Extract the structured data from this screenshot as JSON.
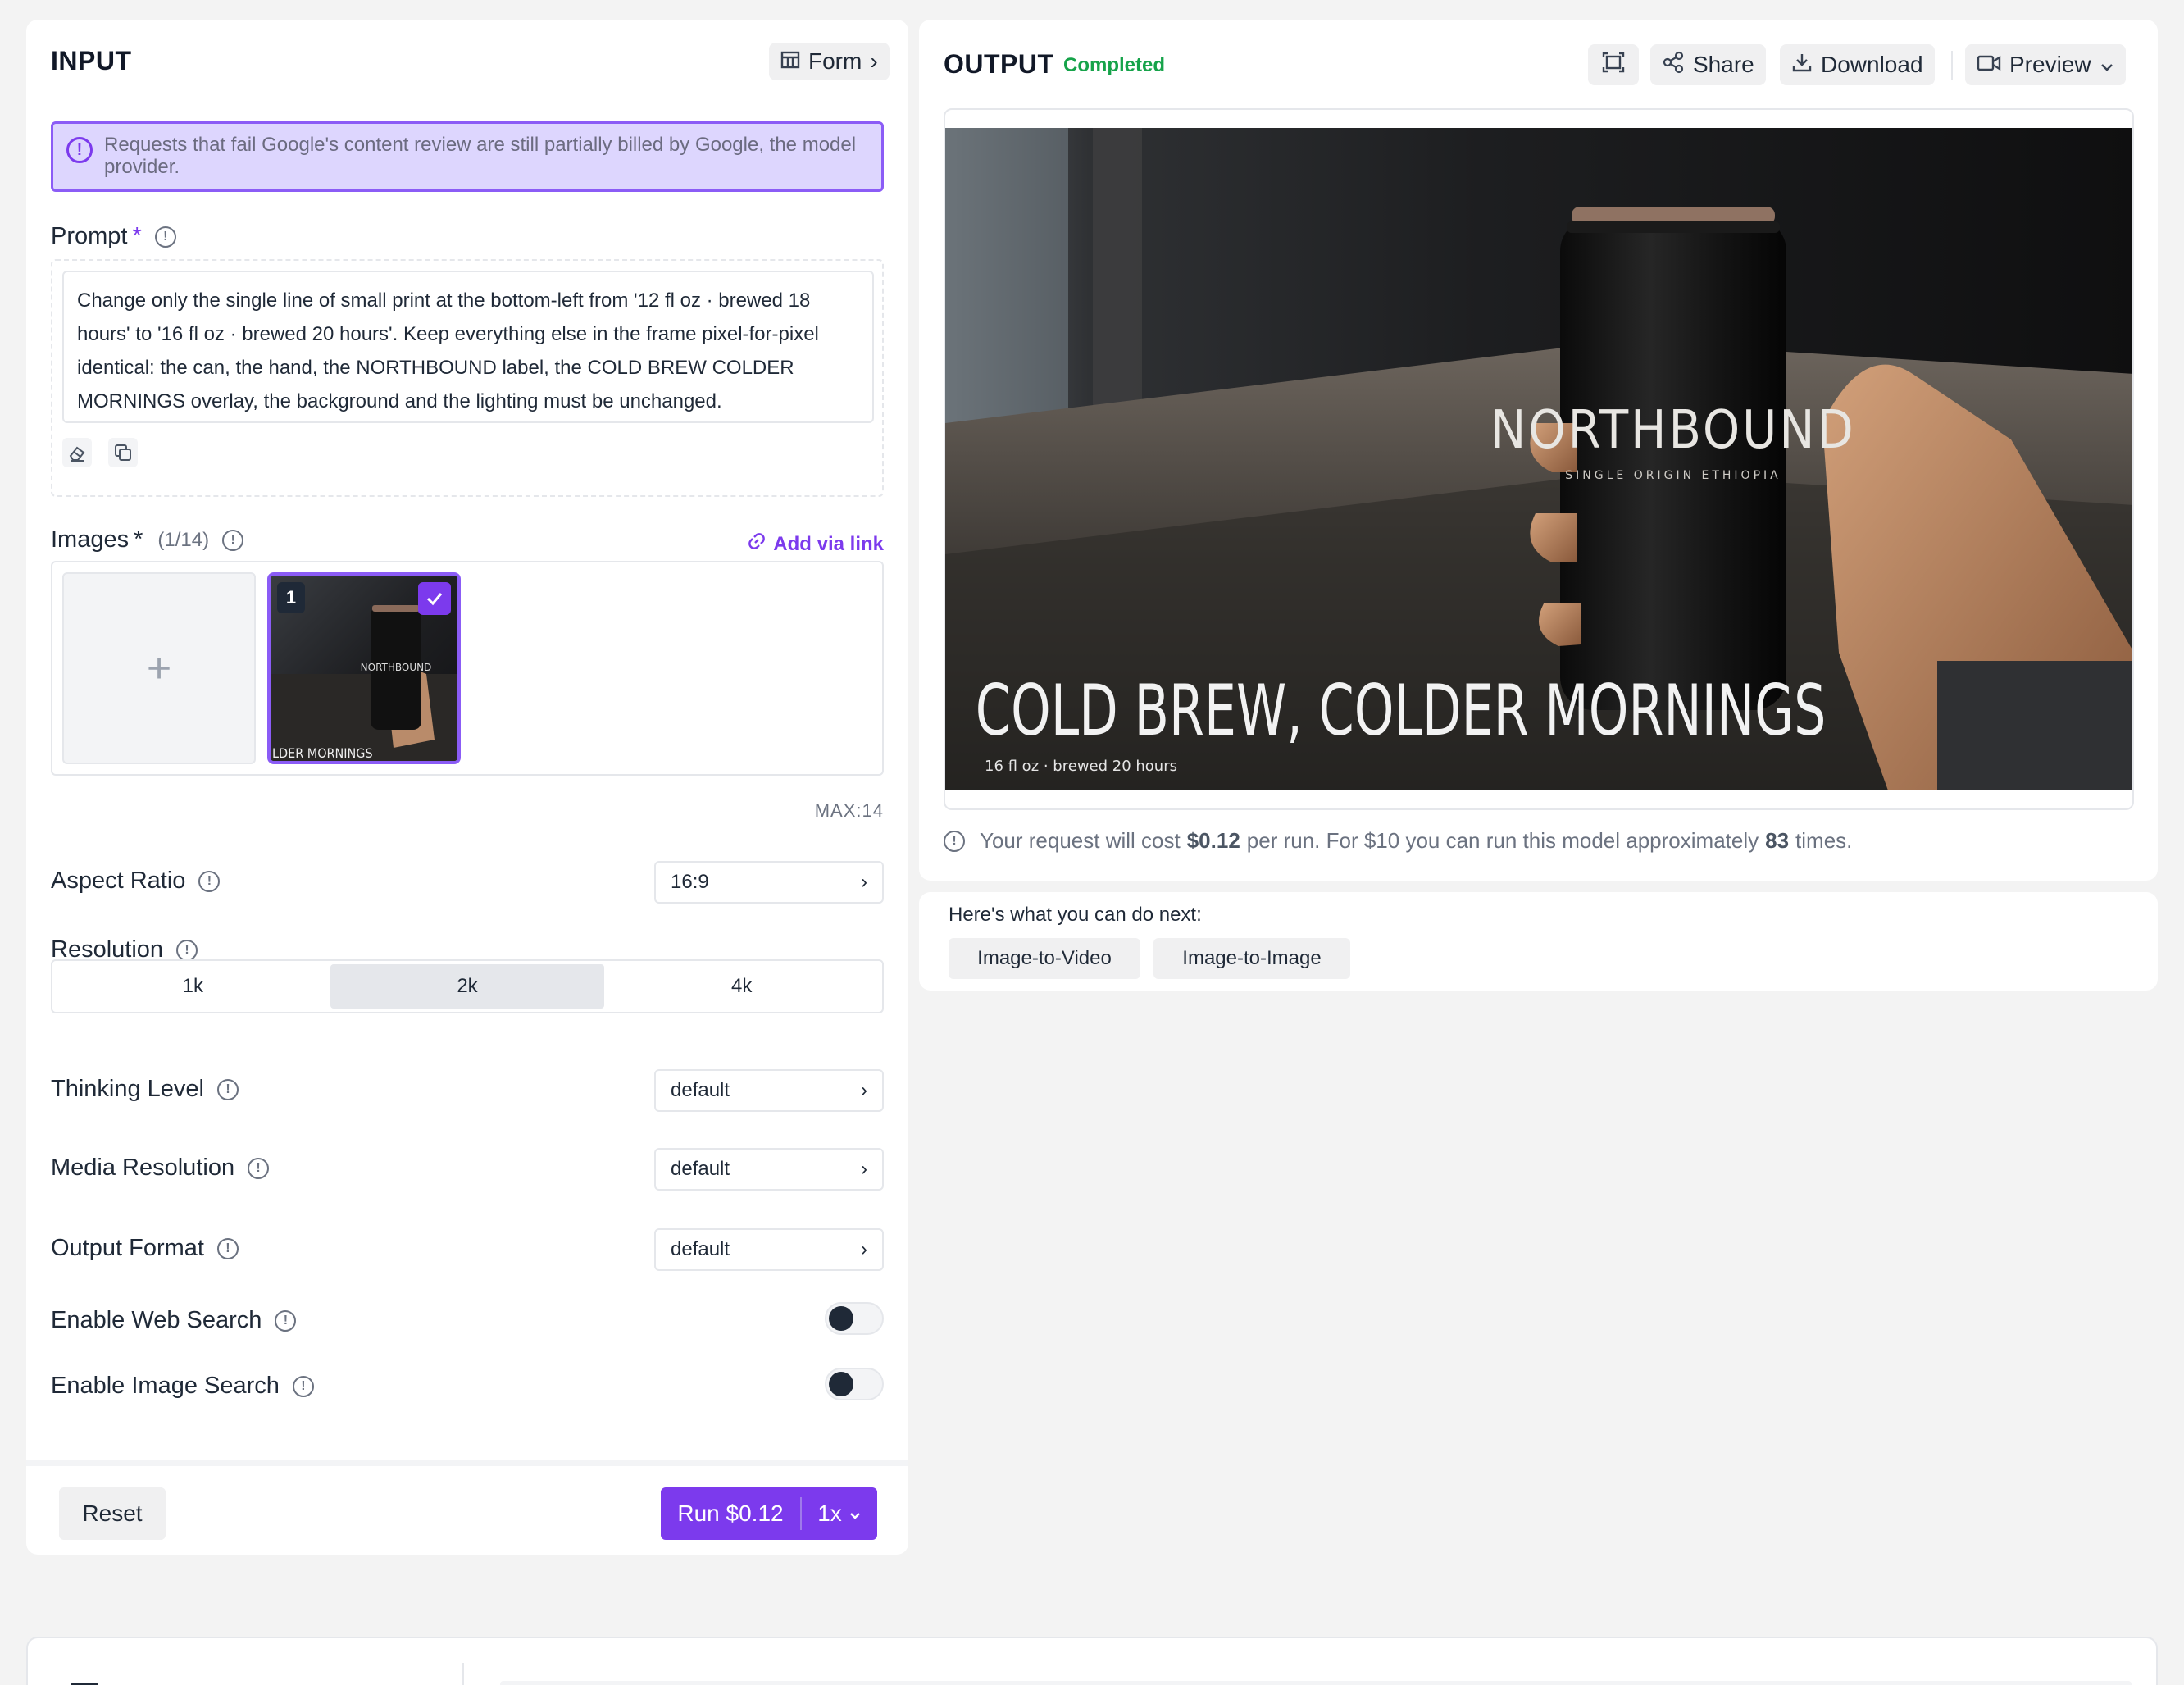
{
  "input": {
    "title": "INPUT",
    "form_label": "Form",
    "alert": "Requests that fail Google's content review are still partially billed by Google, the model provider.",
    "prompt_label": "Prompt",
    "required_mark": "*",
    "prompt_text": "Change only the single line of small print at the bottom-left from '12 fl oz · brewed 18 hours' to '16 fl oz · brewed 20 hours'. Keep everything else in the frame pixel-for-pixel identical: the can, the hand, the NORTHBOUND label, the COLD BREW COLDER MORNINGS overlay, the background and the lighting must be unchanged.",
    "images_label": "Images",
    "images_count": "(1/14)",
    "add_via_link": "Add via link",
    "thumb_number": "1",
    "max_note": "MAX:14",
    "aspect_ratio_label": "Aspect Ratio",
    "aspect_ratio_value": "16:9",
    "resolution_label": "Resolution",
    "resolution_options": [
      "1k",
      "2k",
      "4k"
    ],
    "resolution_selected": "2k",
    "thinking_label": "Thinking Level",
    "thinking_value": "default",
    "media_res_label": "Media Resolution",
    "media_res_value": "default",
    "output_format_label": "Output Format",
    "output_format_value": "default",
    "web_search_label": "Enable Web Search",
    "image_search_label": "Enable Image Search",
    "reset_label": "Reset",
    "run_label": "Run $0.12",
    "run_multiplier": "1x"
  },
  "output": {
    "title": "OUTPUT",
    "status": "Completed",
    "share_label": "Share",
    "download_label": "Download",
    "preview_label": "Preview",
    "image": {
      "brand": "NORTHBOUND",
      "sub_brand": "SINGLE ORIGIN ETHIOPIA",
      "headline": "COLD BREW, COLDER MORNINGS",
      "small_print": "16 fl oz · brewed 20 hours",
      "thumb_headline": "LDER MORNINGS"
    },
    "cost_prefix": "Your request will cost",
    "cost_value": "$0.12",
    "cost_middle": "per run. For $10 you can run this model approximately",
    "cost_runs": "83",
    "cost_suffix": "times."
  },
  "next": {
    "label": "Here's what you can do next:",
    "chips": [
      "Image-to-Video",
      "Image-to-Image"
    ]
  },
  "colors": {
    "accent": "#7c3aed",
    "status_green": "#16a34a",
    "alert_bg": "#ddd6fe"
  }
}
